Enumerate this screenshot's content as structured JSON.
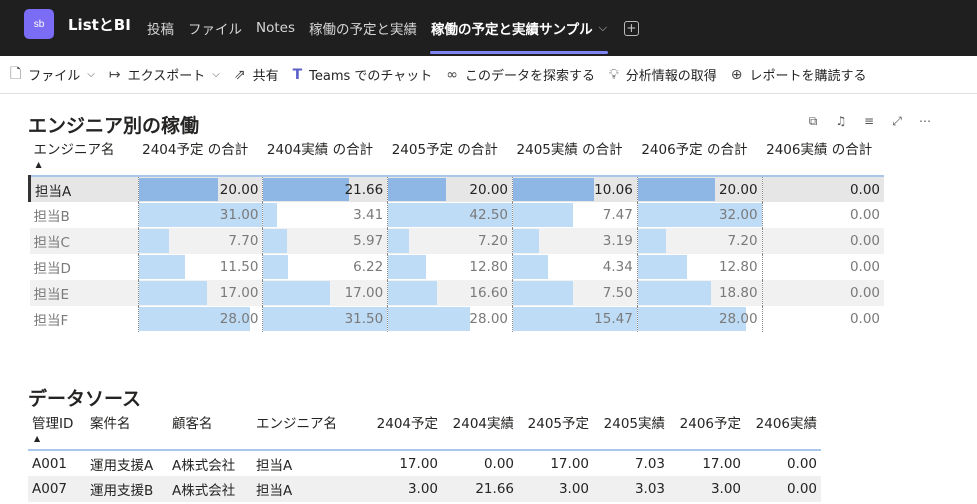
{
  "app": {
    "icon_text": "sb",
    "title": "ListとBI"
  },
  "tabs": [
    {
      "label": "投稿"
    },
    {
      "label": "ファイル"
    },
    {
      "label": "Notes"
    },
    {
      "label": "稼働の予定と実績"
    },
    {
      "label": "稼働の予定と実績サンプル"
    }
  ],
  "toolbar": {
    "file": "ファイル",
    "export": "エクスポート",
    "share": "共有",
    "teams_chat": "Teams でのチャット",
    "explore": "このデータを探索する",
    "insights": "分析情報の取得",
    "subscribe": "レポートを購読する"
  },
  "visual1": {
    "title": "エンジニア別の稼働",
    "columns": [
      "エンジニア名",
      "2404予定 の合計",
      "2404実績 の合計",
      "2405予定 の合計",
      "2405実績 の合計",
      "2406予定 の合計",
      "2406実績 の合計"
    ],
    "rows": [
      {
        "name": "担当A",
        "values": [
          "20.00",
          "21.66",
          "20.00",
          "10.06",
          "20.00",
          "0.00"
        ]
      },
      {
        "name": "担当B",
        "values": [
          "31.00",
          "3.41",
          "42.50",
          "7.47",
          "32.00",
          "0.00"
        ]
      },
      {
        "name": "担当C",
        "values": [
          "7.70",
          "5.97",
          "7.20",
          "3.19",
          "7.20",
          "0.00"
        ]
      },
      {
        "name": "担当D",
        "values": [
          "11.50",
          "6.22",
          "12.80",
          "4.34",
          "12.80",
          "0.00"
        ]
      },
      {
        "name": "担当E",
        "values": [
          "17.00",
          "17.00",
          "16.60",
          "7.50",
          "18.80",
          "0.00"
        ]
      },
      {
        "name": "担当F",
        "values": [
          "28.00",
          "31.50",
          "28.00",
          "15.47",
          "28.00",
          "0.00"
        ]
      }
    ]
  },
  "visual2": {
    "title": "データソース",
    "columns": [
      "管理ID",
      "案件名",
      "顧客名",
      "エンジニア名",
      "2404予定",
      "2404実績",
      "2405予定",
      "2405実績",
      "2406予定",
      "2406実績"
    ],
    "rows": [
      [
        "A001",
        "運用支援A",
        "A株式会社",
        "担当A",
        "17.00",
        "0.00",
        "17.00",
        "7.03",
        "17.00",
        "0.00"
      ],
      [
        "A007",
        "運用支援B",
        "A株式会社",
        "担当A",
        "3.00",
        "21.66",
        "3.00",
        "3.03",
        "3.00",
        "0.00"
      ]
    ]
  }
}
